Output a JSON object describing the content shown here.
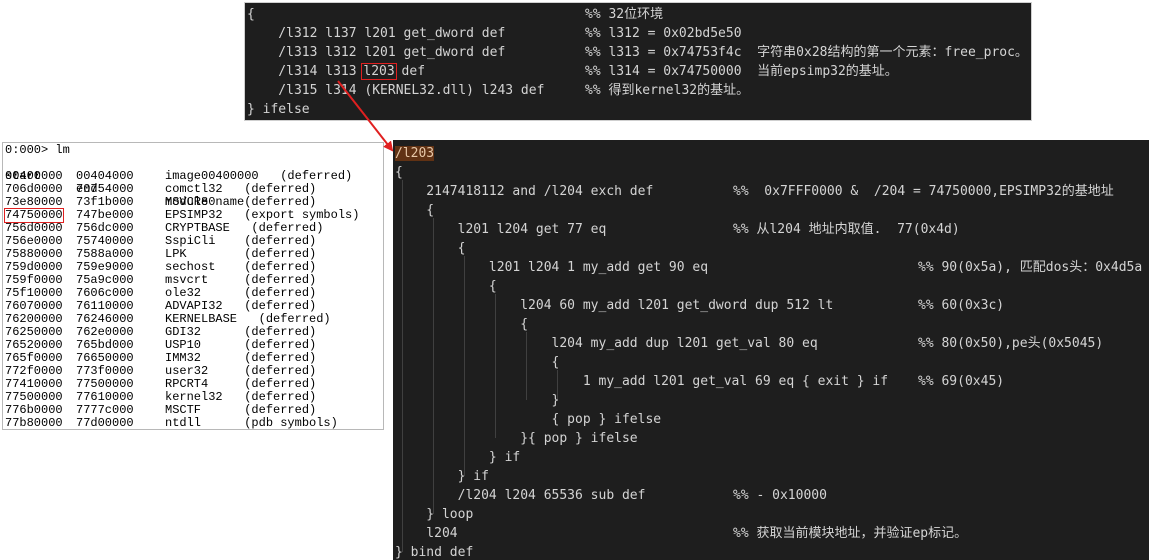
{
  "top_code": {
    "lines": [
      {
        "code": "{",
        "comment": "%% 32位环境"
      },
      {
        "code": "    /l312 l137 l201 get_dword def",
        "comment": "%% l312 = 0x02bd5e50"
      },
      {
        "code": "    /l313 l312 l201 get_dword def",
        "comment": "%% l313 = 0x74753f4c  字符串0x28结构的第一个元素：free_proc。"
      },
      {
        "code_pre": "    /l314 l313 ",
        "code_hl": "l203",
        "code_post": " def",
        "comment": "%% l314 = 0x74750000  当前epsimp32的基址。"
      },
      {
        "code": "    /l315 l314 (KERNEL32.dll) l243 def",
        "comment": "%% 得到kernel32的基址。"
      },
      {
        "code": "} ifelse",
        "comment": ""
      }
    ]
  },
  "modules": {
    "prompt": "0:000> lm",
    "header": {
      "start": "start",
      "end": "end",
      "name": "module name"
    },
    "rows": [
      {
        "start": "00400000",
        "end": "00404000",
        "name": "image00400000   (deferred)"
      },
      {
        "start": "706d0000",
        "end": "70754000",
        "name": "comctl32   (deferred)"
      },
      {
        "start": "73e80000",
        "end": "73f1b000",
        "name": "MSVCR80    (deferred)"
      },
      {
        "start": "74750000",
        "end": "747be000",
        "name": "EPSIMP32   (export symbols)",
        "highlight": true
      },
      {
        "start": "756d0000",
        "end": "756dc000",
        "name": "CRYPTBASE   (deferred)"
      },
      {
        "start": "756e0000",
        "end": "75740000",
        "name": "SspiCli    (deferred)"
      },
      {
        "start": "75880000",
        "end": "7588a000",
        "name": "LPK        (deferred)"
      },
      {
        "start": "759d0000",
        "end": "759e9000",
        "name": "sechost    (deferred)"
      },
      {
        "start": "759f0000",
        "end": "75a9c000",
        "name": "msvcrt     (deferred)"
      },
      {
        "start": "75f10000",
        "end": "7606c000",
        "name": "ole32      (deferred)"
      },
      {
        "start": "76070000",
        "end": "76110000",
        "name": "ADVAPI32   (deferred)"
      },
      {
        "start": "76200000",
        "end": "76246000",
        "name": "KERNELBASE   (deferred)"
      },
      {
        "start": "76250000",
        "end": "762e0000",
        "name": "GDI32      (deferred)"
      },
      {
        "start": "76520000",
        "end": "765bd000",
        "name": "USP10      (deferred)"
      },
      {
        "start": "765f0000",
        "end": "76650000",
        "name": "IMM32      (deferred)"
      },
      {
        "start": "772f0000",
        "end": "773f0000",
        "name": "user32     (deferred)"
      },
      {
        "start": "77410000",
        "end": "77500000",
        "name": "RPCRT4     (deferred)"
      },
      {
        "start": "77500000",
        "end": "77610000",
        "name": "kernel32   (deferred)"
      },
      {
        "start": "776b0000",
        "end": "7777c000",
        "name": "MSCTF      (deferred)"
      },
      {
        "start": "77b80000",
        "end": "77d00000",
        "name": "ntdll      (pdb symbols)"
      }
    ]
  },
  "main_code": {
    "name": "/l203",
    "lines": [
      {
        "code": "{",
        "comment": ""
      },
      {
        "code": "    2147418112 and /l204 exch def",
        "comment": "%%  0x7FFF0000 &  /204 = 74750000,EPSIMP32的基地址"
      },
      {
        "code": "    {",
        "comment": ""
      },
      {
        "code": "        l201 l204 get 77 eq",
        "comment": "%% 从l204 地址内取值.  77(0x4d)"
      },
      {
        "code": "        {",
        "comment": ""
      },
      {
        "code": "            l201 l204 1 my_add get 90 eq",
        "comment": "%% 90(0x5a), 匹配dos头：0x4d5a"
      },
      {
        "code": "            {",
        "comment": ""
      },
      {
        "code": "                l204 60 my_add l201 get_dword dup 512 lt",
        "comment": "%% 60(0x3c)"
      },
      {
        "code": "                {",
        "comment": ""
      },
      {
        "code": "                    l204 my_add dup l201 get_val 80 eq",
        "comment": "%% 80(0x50),pe头(0x5045)"
      },
      {
        "code": "                    {",
        "comment": ""
      },
      {
        "code": "                        1 my_add l201 get_val 69 eq { exit } if",
        "comment": "%% 69(0x45)"
      },
      {
        "code": "                    }",
        "comment": ""
      },
      {
        "code": "                    { pop } ifelse",
        "comment": ""
      },
      {
        "code": "                }{ pop } ifelse",
        "comment": ""
      },
      {
        "code": "            } if",
        "comment": ""
      },
      {
        "code": "        } if",
        "comment": ""
      },
      {
        "code": "        /l204 l204 65536 sub def",
        "comment": "%% - 0x10000"
      },
      {
        "code": "    } loop",
        "comment": ""
      },
      {
        "code": "    l204",
        "comment": "%% 获取当前模块地址，并验证ep标记。"
      },
      {
        "code": "} bind def",
        "comment": ""
      }
    ]
  },
  "colors": {
    "editor_bg": "#1e1e1e",
    "text": "#d4d4d4",
    "annotation_red": "#e02020",
    "name_highlight": "#613214"
  }
}
